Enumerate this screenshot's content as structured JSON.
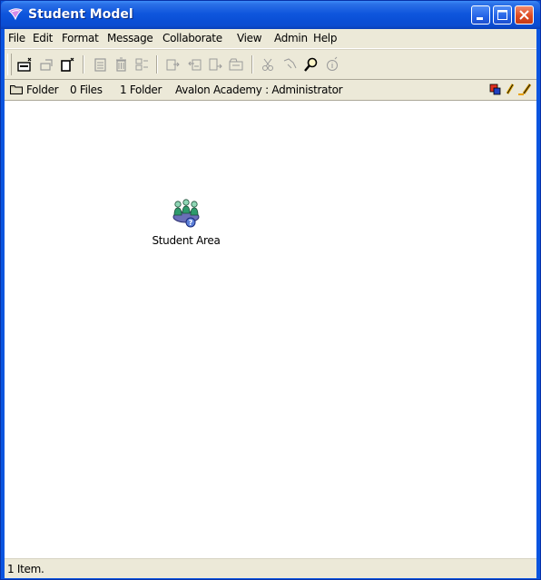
{
  "window": {
    "title": "Student Model"
  },
  "menu": {
    "items": [
      "File",
      "Edit",
      "Format",
      "Message",
      "Collaborate",
      "View",
      "Admin",
      "Help"
    ]
  },
  "toolbar": {
    "icons": [
      "new-document-icon",
      "open-icon",
      "new-page-icon",
      "list-icon",
      "delete-icon",
      "properties-icon",
      "send-icon",
      "reply-icon",
      "forward-icon",
      "folder-view-icon",
      "cut-icon",
      "copy-icon",
      "search-icon",
      "info-icon"
    ]
  },
  "path": {
    "kind": "Folder",
    "files": "0 Files",
    "folders": "1 Folder",
    "location": "Avalon Academy : Administrator"
  },
  "content": {
    "items": [
      {
        "label": "Student Area",
        "icon": "student-group-icon"
      }
    ]
  },
  "status": {
    "text": "1 Item."
  },
  "colors": {
    "titlebar": "#0a55e0",
    "chrome": "#ece9d8",
    "close_button": "#de4b22"
  }
}
